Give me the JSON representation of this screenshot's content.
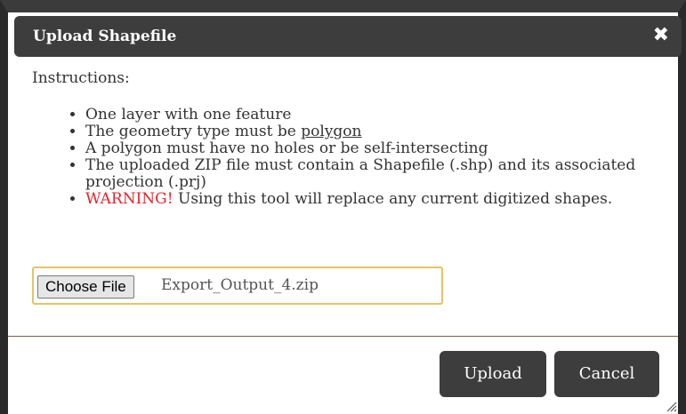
{
  "dialog": {
    "title": "Upload Shapefile",
    "close_icon": "✖",
    "instructions_label": "Instructions:",
    "items": [
      {
        "text": "One layer with one feature"
      },
      {
        "prefix": "The geometry type must be ",
        "link": "polygon"
      },
      {
        "text": "A polygon must have no holes or be self-intersecting"
      },
      {
        "text": "The uploaded ZIP file must contain a Shapefile (.shp) and its associated projection (.prj)"
      },
      {
        "warning": "WARNING!",
        "text": " Using this tool will replace any current digitized shapes."
      }
    ],
    "file_input": {
      "button_label": "Choose File",
      "file_name": "Export_Output_4.zip"
    },
    "buttons": {
      "upload": "Upload",
      "cancel": "Cancel"
    }
  },
  "colors": {
    "titlebar": "#3d3d3d",
    "warning": "#e8232a",
    "file_box_border": "#e5c36a"
  }
}
